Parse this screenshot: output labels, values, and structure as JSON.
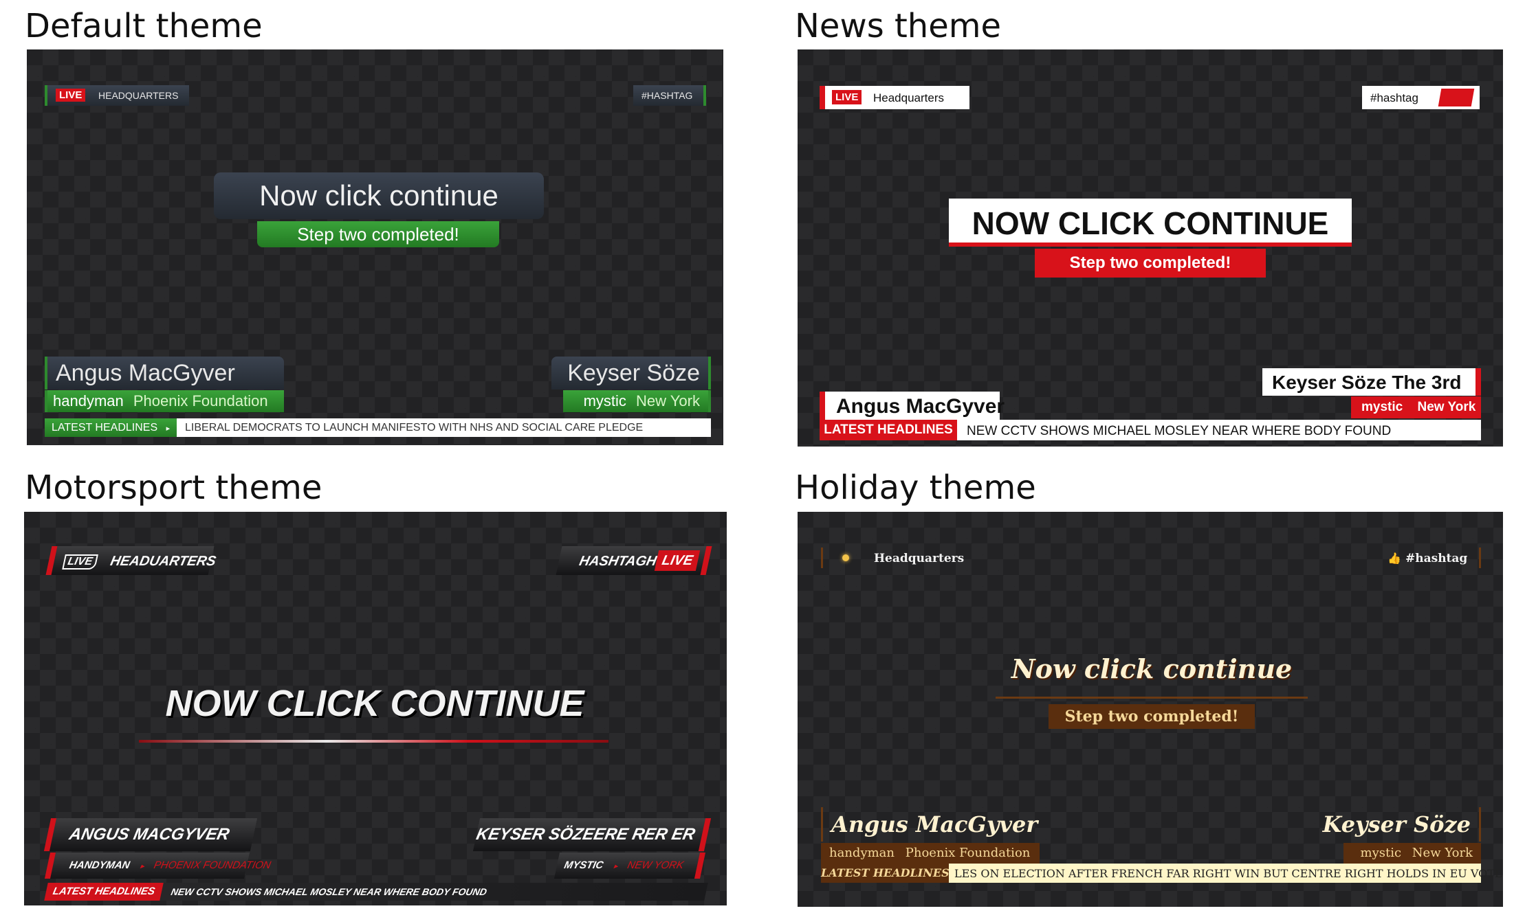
{
  "sections": {
    "default": {
      "title": "Default theme"
    },
    "news": {
      "title": "News theme"
    },
    "motor": {
      "title": "Motorsport theme"
    },
    "holiday": {
      "title": "Holiday theme"
    }
  },
  "default": {
    "live": "LIVE",
    "location": "HEADQUARTERS",
    "hashtag": "#HASHTAG",
    "headline": "Now click continue",
    "sub": "Step two completed!",
    "left_name": "Angus MacGyver",
    "left_role": "handyman",
    "left_org": "Phoenix Foundation",
    "right_name": "Keyser Söze",
    "right_role": "mystic",
    "right_place": "New York",
    "ticker_label": "LATEST HEADLINES",
    "ticker_arrow": "▸",
    "ticker_text": "LIBERAL DEMOCRATS TO LAUNCH MANIFESTO WITH NHS AND SOCIAL CARE PLEDGE"
  },
  "news": {
    "live": "LIVE",
    "location": "Headquarters",
    "hashtag": "#hashtag",
    "headline": "NOW CLICK CONTINUE",
    "sub": "Step two completed!",
    "left_name": "Angus MacGyver",
    "right_name": "Keyser Söze The 3rd",
    "right_role": "mystic",
    "right_place": "New York",
    "ticker_label": "LATEST HEADLINES",
    "ticker_text": "NEW CCTV SHOWS MICHAEL MOSLEY NEAR WHERE BODY FOUND"
  },
  "motor": {
    "live": "LIVE",
    "location": "HEADUARTERS",
    "hashtag": "HASHTAGH",
    "live_right": "LIVE",
    "headline": "NOW CLICK CONTINUE",
    "left_name": "ANGUS MACGYVER",
    "left_role": "HANDYMAN",
    "left_org": "PHOENIX FOUNDATION",
    "right_name": "KEYSER SÖZEERE RER ER",
    "right_role": "MYSTIC",
    "right_place": "NEW YORK",
    "arrow": "▸",
    "ticker_label": "LATEST HEADLINES",
    "ticker_text": "NEW CCTV SHOWS MICHAEL MOSLEY NEAR WHERE BODY FOUND"
  },
  "holiday": {
    "location": "Headquarters",
    "hashtag": "#hashtag",
    "thumb": "👍",
    "headline": "Now click continue",
    "sub": "Step two completed!",
    "left_name": "Angus MacGyver",
    "left_role": "handyman",
    "left_org": "Phoenix Foundation",
    "right_name": "Keyser Söze",
    "right_role": "mystic",
    "right_place": "New York",
    "ticker_label": "LATEST HEADLINES",
    "ticker_text": "LES ON ELECTION AFTER FRENCH FAR RIGHT WIN BUT CENTRE RIGHT HOLDS IN EU VOTE"
  },
  "colors": {
    "default_accent": "#2e8b2e",
    "news_accent": "#d8121a",
    "motor_accent": "#d0111a",
    "holiday_accent": "#5a2e0e"
  }
}
